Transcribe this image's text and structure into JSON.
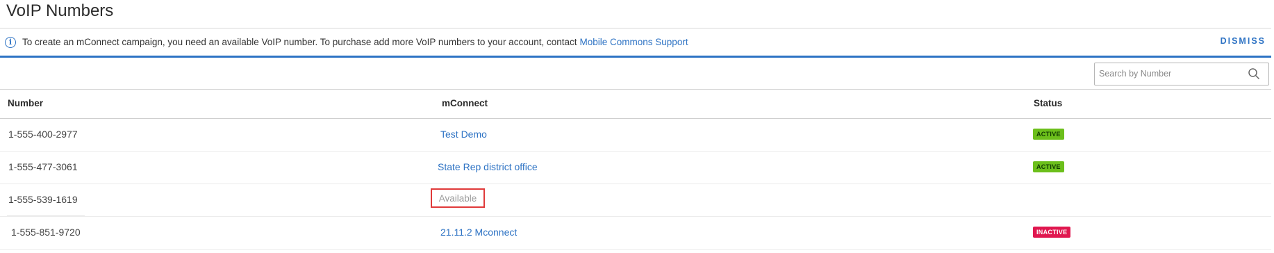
{
  "page": {
    "title": "VoIP Numbers"
  },
  "banner": {
    "message": "To create an mConnect campaign, you need an available VoIP number. To purchase add more VoIP numbers to your account, contact",
    "link_label": "Mobile Commons Support",
    "dismiss_label": "DISMISS",
    "icon": "info-icon"
  },
  "search": {
    "placeholder": "Search by Number",
    "value": ""
  },
  "table": {
    "headers": {
      "number": "Number",
      "mconnect": "mConnect",
      "status": "Status"
    },
    "rows": [
      {
        "number": "1-555-400-2977",
        "mconnect": "Test Demo",
        "status": "ACTIVE"
      },
      {
        "number": "1-555-477-3061",
        "mconnect": "State Rep district office",
        "status": "ACTIVE"
      },
      {
        "number": "1-555-539-1619",
        "mconnect": "Available",
        "status": ""
      },
      {
        "number": "1-555-851-9720",
        "mconnect": "21.11.2 Mconnect",
        "status": "INACTIVE"
      }
    ]
  },
  "colors": {
    "accent": "#2e73c4",
    "active": "#6cbf1b",
    "inactive": "#e0174f",
    "highlight": "#e03a3a"
  }
}
